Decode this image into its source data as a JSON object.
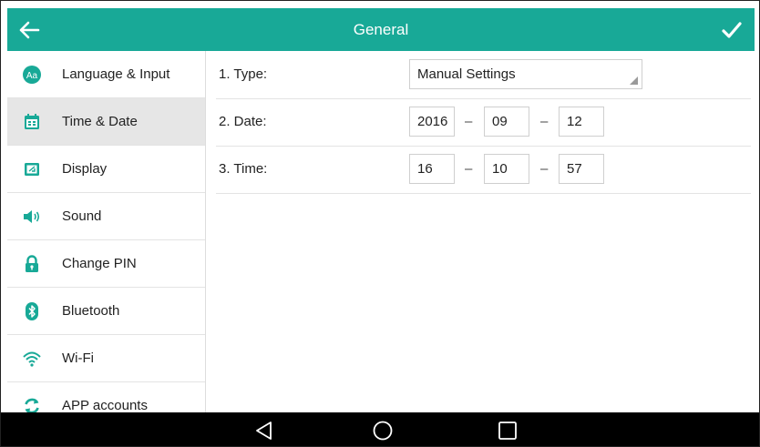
{
  "header": {
    "title": "General",
    "back_icon": "arrow-left-icon",
    "confirm_icon": "checkmark-icon",
    "bar_color": "#18a997"
  },
  "sidebar": {
    "items": [
      {
        "label": "Language & Input",
        "icon": "language-icon",
        "active": false
      },
      {
        "label": "Time & Date",
        "icon": "calendar-icon",
        "active": true
      },
      {
        "label": "Display",
        "icon": "display-icon",
        "active": false
      },
      {
        "label": "Sound",
        "icon": "speaker-icon",
        "active": false
      },
      {
        "label": "Change PIN",
        "icon": "lock-icon",
        "active": false
      },
      {
        "label": "Bluetooth",
        "icon": "bluetooth-icon",
        "active": false
      },
      {
        "label": "Wi-Fi",
        "icon": "wifi-icon",
        "active": false
      },
      {
        "label": "APP accounts",
        "icon": "sync-icon",
        "active": false
      }
    ]
  },
  "settings": {
    "type": {
      "label": "1. Type:",
      "value": "Manual Settings"
    },
    "date": {
      "label": "2. Date:",
      "year": "2016",
      "month": "09",
      "day": "12",
      "separator": "–"
    },
    "time": {
      "label": "3. Time:",
      "hour": "16",
      "minute": "10",
      "second": "57",
      "separator": "–"
    }
  },
  "navbar": {
    "back_icon": "nav-back-triangle-icon",
    "home_icon": "nav-home-circle-icon",
    "recents_icon": "nav-recents-square-icon"
  }
}
